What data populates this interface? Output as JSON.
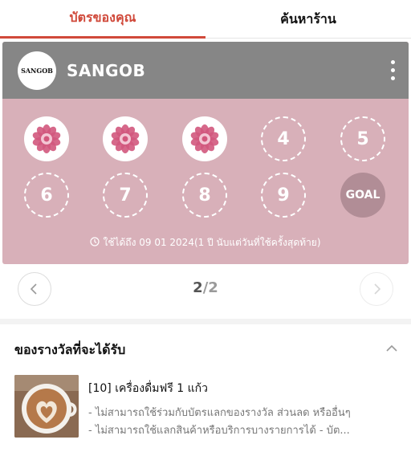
{
  "tabs": [
    "บัตรของคุณ",
    "ค้นหาร้าน"
  ],
  "card": {
    "logo_text": "SANGOB",
    "shop_name": "SANGOB",
    "stamps": [
      {
        "label": "",
        "state": "filled"
      },
      {
        "label": "",
        "state": "filled"
      },
      {
        "label": "",
        "state": "filled"
      },
      {
        "label": "4",
        "state": "empty"
      },
      {
        "label": "5",
        "state": "empty"
      },
      {
        "label": "6",
        "state": "empty"
      },
      {
        "label": "7",
        "state": "empty"
      },
      {
        "label": "8",
        "state": "empty"
      },
      {
        "label": "9",
        "state": "empty"
      },
      {
        "label": "GOAL",
        "state": "goal"
      }
    ],
    "valid_note": "ใช้ได้ถึง 09 01 2024(1 ปี นับแต่วันที่ใช้ครั้งสุดท้าย)"
  },
  "pager": {
    "current": "2",
    "separator": "/",
    "total": "2"
  },
  "rewards": {
    "title": "ของรางวัลที่จะได้รับ",
    "items": [
      {
        "name": "[10] เครื่องดื่มฟรี 1 แก้ว",
        "desc1": "- ไม่สามารถใช้ร่วมกับบัตรแลกของรางวัล ส่วนลด หรืออื่นๆ",
        "desc2": "- ไม่สามารถใช้แลกสินค้าหรือบริการบางรายการได้ - บัต..."
      }
    ]
  },
  "colors": {
    "accent": "#d0493a",
    "card_bg": "#d8b0b9",
    "card_header": "#868686",
    "goal": "#b18d96",
    "flower": "#d2587d"
  },
  "icons": {
    "menu": "more-vertical-icon",
    "clock": "clock-icon",
    "prev": "chevron-left-icon",
    "next": "chevron-right-icon",
    "collapse": "chevron-up-icon",
    "stamp": "flower-icon"
  }
}
